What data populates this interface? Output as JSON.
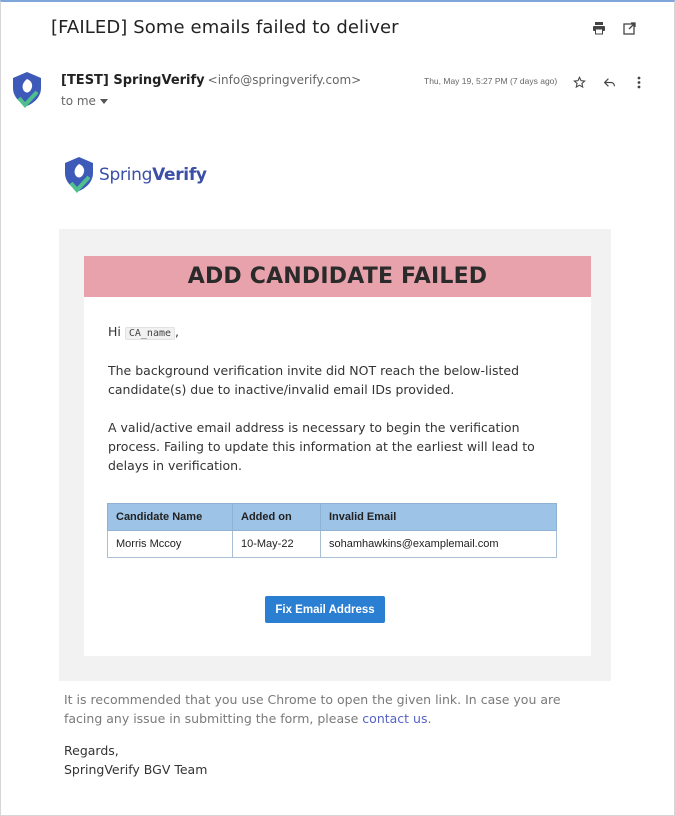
{
  "email": {
    "subject": "[FAILED] Some emails failed to deliver",
    "sender_name": "[TEST] SpringVerify",
    "sender_email": "<info@springverify.com>",
    "to_label": "to me",
    "date": "Thu, May 19, 5:27 PM (7 days ago)"
  },
  "toolbar": {
    "print_icon": "print-icon",
    "open_new_window_icon": "open-in-new-window-icon",
    "star_icon": "star-icon",
    "reply_icon": "reply-icon",
    "more_icon": "more-vertical-icon"
  },
  "logo": {
    "word1": "Spring",
    "word2": "Verify"
  },
  "content": {
    "banner": "ADD CANDIDATE FAILED",
    "greeting_prefix": "Hi",
    "greeting_code": "CA_name",
    "greeting_suffix": ",",
    "paragraph1": "The background verification invite did NOT reach the below-listed candidate(s) due to inactive/invalid email IDs provided.",
    "paragraph2": "A valid/active email address is necessary to begin the verification process. Failing to update this information at the earliest will lead to delays in verification.",
    "table": {
      "headers": [
        "Candidate Name",
        "Added on",
        "Invalid Email"
      ],
      "rows": [
        [
          "Morris Mccoy",
          "10-May-22",
          "sohamhawkins@examplemail.com"
        ]
      ]
    },
    "button_label": "Fix Email Address"
  },
  "footer": {
    "note_prefix": "It is recommended that you use Chrome to open the given link. In case you are facing any issue in submitting the form, please",
    "note_link": "contact us",
    "note_suffix": ".",
    "regards": "Regards,",
    "signature": "SpringVerify BGV Team"
  },
  "colors": {
    "banner_bg": "#e8a2ab",
    "table_header_bg": "#9dc3e6",
    "button_bg": "#2b7fd3",
    "link": "#5563c7",
    "brand": "#3b4ea8"
  }
}
